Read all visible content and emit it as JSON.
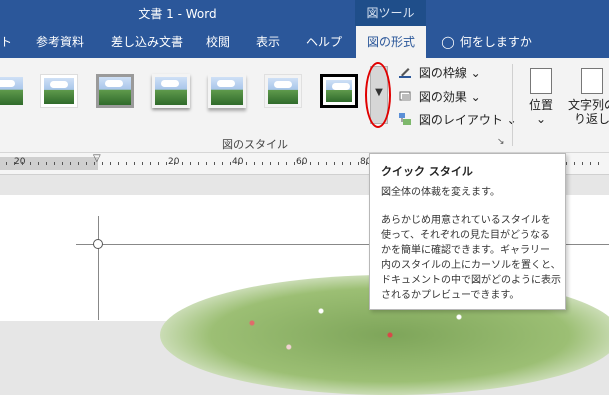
{
  "titlebar": {
    "title": "文書 1  -  Word",
    "context_group": "図ツール"
  },
  "tabs": [
    {
      "label": "ト"
    },
    {
      "label": "参考資料"
    },
    {
      "label": "差し込み文書"
    },
    {
      "label": "校閲"
    },
    {
      "label": "表示"
    },
    {
      "label": "ヘルプ"
    },
    {
      "label": "図の形式"
    },
    {
      "label": "何をしますか"
    }
  ],
  "ribbon": {
    "picture_styles_group_label": "図のスタイル",
    "commands": {
      "border": "図の枠線",
      "effects": "図の効果",
      "layout": "図のレイアウト"
    },
    "arrange": {
      "position_label": "位置",
      "wrap_line1": "文字列の",
      "wrap_line2": "り返し"
    }
  },
  "ruler": {
    "numbers": [
      "20",
      "20",
      "40",
      "60",
      "80"
    ]
  },
  "tooltip": {
    "title": "クイック スタイル",
    "subtitle": "図全体の体裁を変えます。",
    "lines": [
      "あらかじめ用意されているスタイルを",
      "使って、それぞれの見た目がどうなる",
      "かを簡単に確認できます。ギャラリー",
      "内のスタイルの上にカーソルを置くと、",
      "ドキュメントの中で図がどのように表示",
      "されるかプレビューできます。"
    ]
  },
  "colors": {
    "title_bar": "#2b579a",
    "context_group": "#1f4e8a",
    "ribbon": "#f3f3f3",
    "annotation_circle": "#e00000"
  }
}
